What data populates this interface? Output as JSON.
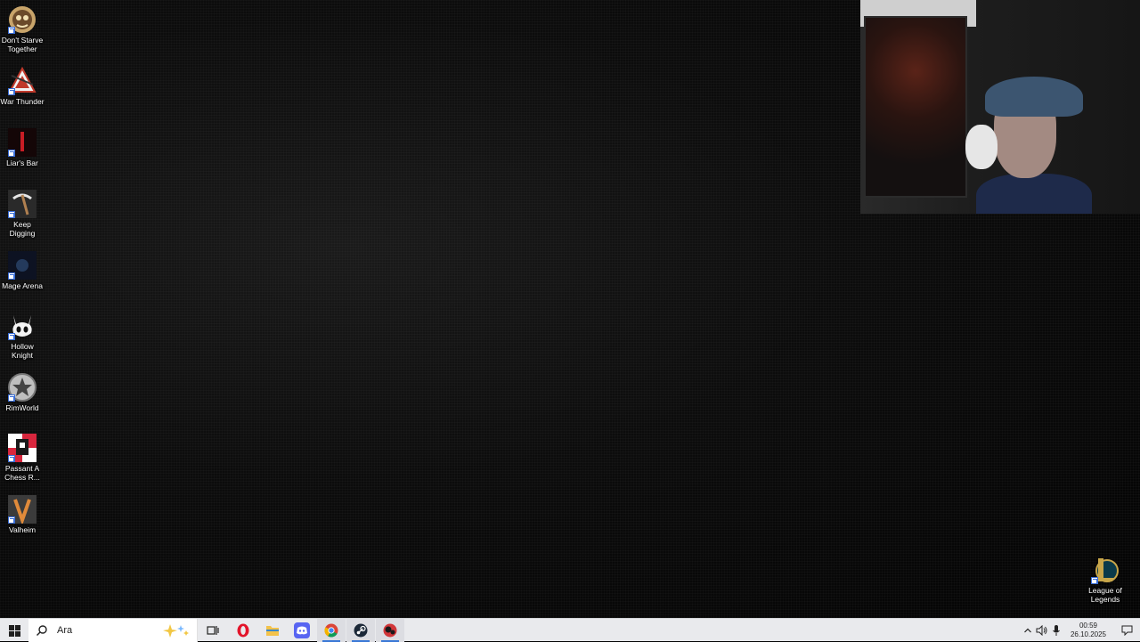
{
  "desktop": {
    "icons": [
      {
        "label": "Don't Starve Together",
        "icon": "dont-starve-together-icon"
      },
      {
        "label": "War Thunder",
        "icon": "war-thunder-icon"
      },
      {
        "label": "Liar's Bar",
        "icon": "liars-bar-icon"
      },
      {
        "label": "Keep Digging",
        "icon": "keep-digging-icon"
      },
      {
        "label": "Mage Arena",
        "icon": "mage-arena-icon"
      },
      {
        "label": "Hollow Knight",
        "icon": "hollow-knight-icon"
      },
      {
        "label": "RimWorld",
        "icon": "rimworld-icon"
      },
      {
        "label": "Passant A Chess R...",
        "icon": "passant-chess-icon"
      },
      {
        "label": "Valheim",
        "icon": "valheim-icon"
      }
    ],
    "right_icon": {
      "label": "League of Legends",
      "icon": "league-of-legends-icon"
    }
  },
  "taskbar": {
    "search_placeholder": "Ara",
    "apps": [
      "task-view-icon",
      "opera-icon",
      "file-explorer-icon",
      "discord-icon",
      "chrome-icon",
      "steam-icon",
      "riot-client-icon"
    ],
    "clock_time": "00:59",
    "clock_date": "26.10.2025"
  },
  "colors": {
    "taskbar_bg": "#e9eaed",
    "accent": "#3a78d6"
  }
}
